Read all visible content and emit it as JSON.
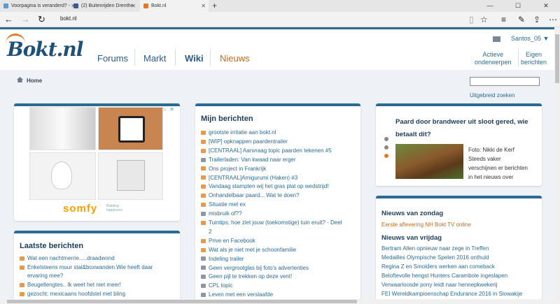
{
  "browser": {
    "tabs": [
      {
        "label": "Voorpagina is veranderd? -",
        "fav": "#5b9bd5"
      },
      {
        "label": "(2) Buitenrijden Drenthe",
        "fav": "#3b5998"
      },
      {
        "label": "Bokt.nl",
        "fav": "#e07a28"
      }
    ],
    "url": "bokt.nl",
    "icons": [
      "back-icon",
      "forward-icon",
      "refresh-icon",
      "reading-view-icon",
      "favorite-star-icon",
      "hub-icon",
      "note-icon",
      "share-icon",
      "more-icon"
    ]
  },
  "site": {
    "logo": "Bokt.nl",
    "nav": [
      "Forums",
      "Markt",
      "Wiki",
      "Nieuws"
    ],
    "user": "Santos_05 ▼",
    "header_links": [
      {
        "line1": "Actieve",
        "line2": "onderwerpen"
      },
      {
        "line1": "Eigen",
        "line2": "berichten"
      }
    ],
    "breadcrumb": "Home",
    "advanced_search": "Uitgebreid zoeken",
    "colors": {
      "accent": "#2b6a93",
      "orange": "#e07a28",
      "bg": "#eef2f6"
    }
  },
  "ad": {
    "brand": "somfy",
    "tagline1": "Building",
    "tagline2": "happiness"
  },
  "laatste": {
    "title": "Laatste berichten",
    "items": [
      "Wat een nachtmerrie.....draadwond",
      "Enkelsteens muur stal&boxwanden.Wie heeft daar",
      "ervaring mee?",
      "Beugellengtes.. Ik weet het niet meer!",
      "gezocht; mexicaans hoofdstel met bling"
    ]
  },
  "mijn": {
    "title": "Mijn berichten",
    "items": [
      {
        "t": "grootste irritatie aan bokt.nl",
        "c": "o"
      },
      {
        "t": "[WIP] opknappen paardentrailer",
        "c": "o"
      },
      {
        "t": "[CENTRAAL] Aanvraag topic paarden tekenen #5",
        "c": "o"
      },
      {
        "t": "Trailerladen: Van kwaad naar erger",
        "c": "g"
      },
      {
        "t": "Ons project in Frankrijk",
        "c": "o"
      },
      {
        "t": "[CENTRAAL]Amigurumi (Haken) #3",
        "c": "o"
      },
      {
        "t": "Vandaag stampten wij het gras plat op wedstrijd!",
        "c": "o"
      },
      {
        "t": "Onhandelbaar paard... Wat te doen?",
        "c": "o"
      },
      {
        "t": "Situatie met ex",
        "c": "o"
      },
      {
        "t": "misbruik of??",
        "c": "g"
      },
      {
        "t": "Tuintips; hoe ziet jouw (toekomstige) tuin eruit? - Deel",
        "c": "o"
      },
      {
        "t": "2",
        "c": "none"
      },
      {
        "t": "Prive en Facebook",
        "c": "o"
      },
      {
        "t": "Wat als je niet met je schoonfamilie",
        "c": "o"
      },
      {
        "t": "Indeling trailer",
        "c": "g"
      },
      {
        "t": "Geen vergrootglas bij foto's advertenties",
        "c": "g"
      },
      {
        "t": "Geen pijl te trekken op deze vent!",
        "c": "g"
      },
      {
        "t": "CPL topic",
        "c": "g"
      },
      {
        "t": "Leven met een verslaafde",
        "c": "g"
      },
      {
        "t": "[CENTRAAL] castreren",
        "c": "o"
      }
    ]
  },
  "feature": {
    "title1": "Paard door brandweer uit sloot gered, wie",
    "title2": "betaalt dit?",
    "caption": [
      "Foto: Nikki de Kerf",
      "Steeds vaker",
      "verschijnen er berichten",
      "in het nieuws over"
    ]
  },
  "news": {
    "sunday_title": "Nieuws van zondag",
    "sunday_items": [
      "Eerste aflevering NH Bokt TV online"
    ],
    "friday_title": "Nieuws van vrijdag",
    "friday_items": [
      "Bertram Allen opnieuw naar zege in Treffen",
      "Medailles Olympische Spelen 2016 onthuld",
      "Regina Z en Smolders werken aan comeback",
      "Beloftevolle hengst Hunters Carambole ingeslapen",
      "Verwaarloosde pony leidt naar hennepkwekerij",
      "FEI Wereldkampioenschap Endurance 2016 in Slowakije"
    ]
  }
}
